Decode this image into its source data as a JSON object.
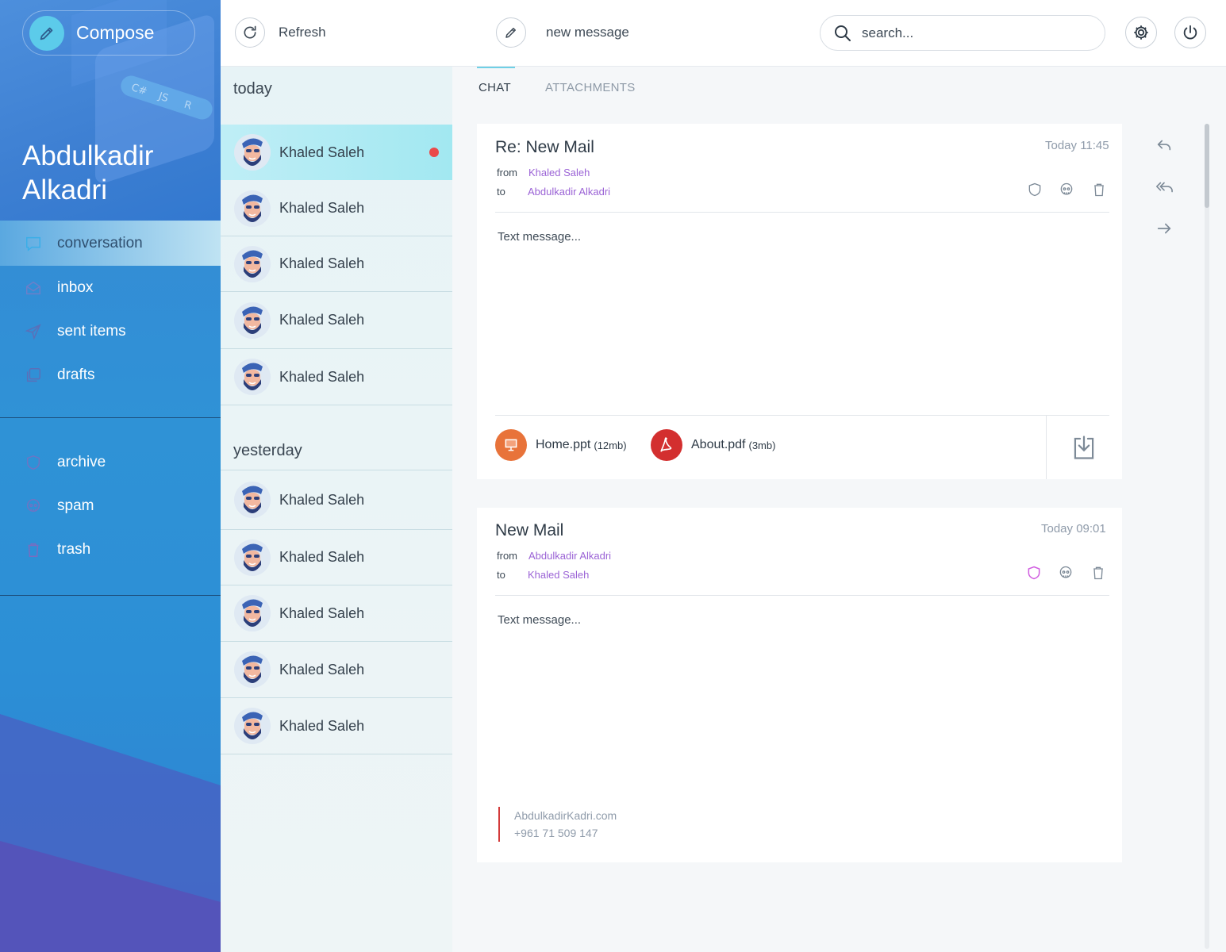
{
  "sidebar": {
    "compose_label": "Compose",
    "user_first": "Abdulkadir",
    "user_last": "Alkadri",
    "nav": [
      {
        "label": "conversation",
        "icon": "chat-icon",
        "active": true
      },
      {
        "label": "inbox",
        "icon": "inbox-icon"
      },
      {
        "label": "sent items",
        "icon": "send-icon"
      },
      {
        "label": "drafts",
        "icon": "drafts-icon"
      }
    ],
    "nav2": [
      {
        "label": "archive",
        "icon": "shield-icon"
      },
      {
        "label": "spam",
        "icon": "skull-icon"
      },
      {
        "label": "trash",
        "icon": "trash-icon"
      }
    ],
    "hero_tags": [
      "C#",
      "JS",
      "R"
    ]
  },
  "topbar": {
    "refresh_label": "Refresh",
    "new_message_label": "new message",
    "search_placeholder": "search..."
  },
  "conversations": {
    "today_label": "today",
    "yesterday_label": "yesterday",
    "today": [
      {
        "name": "Khaled Saleh",
        "unread": true
      },
      {
        "name": "Khaled Saleh"
      },
      {
        "name": "Khaled Saleh"
      },
      {
        "name": "Khaled Saleh"
      },
      {
        "name": "Khaled Saleh"
      }
    ],
    "yesterday": [
      {
        "name": "Khaled Saleh"
      },
      {
        "name": "Khaled Saleh"
      },
      {
        "name": "Khaled Saleh"
      },
      {
        "name": "Khaled Saleh"
      },
      {
        "name": "Khaled Saleh"
      }
    ]
  },
  "main": {
    "tabs": [
      {
        "label": "CHAT",
        "active": true
      },
      {
        "label": "ATTACHMENTS"
      }
    ],
    "messages": [
      {
        "subject": "Re: New Mail",
        "time": "Today 11:45",
        "from_label": "from",
        "from": "Khaled Saleh",
        "to_label": "to",
        "to": "Abdulkadir Alkadri",
        "body": "Text message...",
        "attachments": [
          {
            "name": "Home.ppt",
            "size": "(12mb)",
            "color": "#e8733a",
            "icon": "presentation-icon"
          },
          {
            "name": "About.pdf",
            "size": "(3mb)",
            "color": "#d32f2f",
            "icon": "pdf-icon"
          }
        ]
      },
      {
        "subject": "New Mail",
        "time": "Today 09:01",
        "from_label": "from",
        "from": "Abdulkadir Alkadri",
        "to_label": "to",
        "to": "Khaled Saleh",
        "body": "Text message...",
        "signature": [
          "AbdulkadirKadri.com",
          "+961 71 509 147"
        ]
      }
    ]
  },
  "colors": {
    "accent_purple": "#9b63d6",
    "accent_cyan": "#5ccbea",
    "unread_dot": "#ea4a4a",
    "shield_highlight": "#d05ce0"
  }
}
